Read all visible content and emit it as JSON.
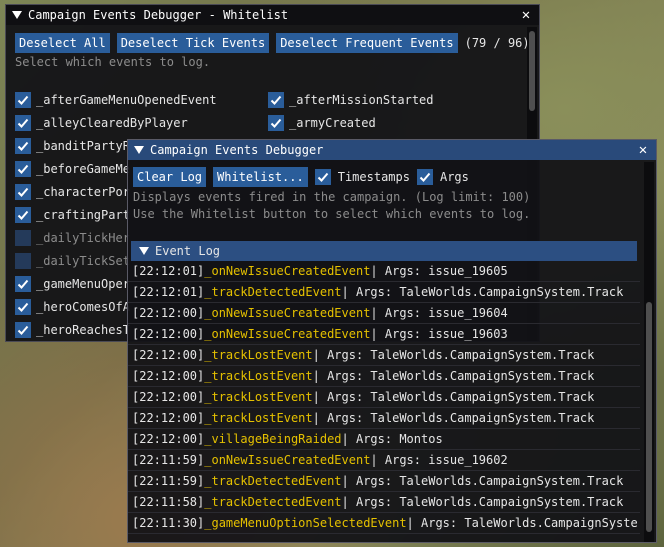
{
  "whitelist": {
    "title": "Campaign Events Debugger - Whitelist",
    "deselect_all": "Deselect All",
    "deselect_tick": "Deselect Tick Events",
    "deselect_frequent": "Deselect Frequent Events",
    "count": "(79 / 96)",
    "hint": "Select which events to log.",
    "left_items": [
      {
        "label": "_afterGameMenuOpenedEvent",
        "checked": true
      },
      {
        "label": "_alleyClearedByPlayer",
        "checked": true
      },
      {
        "label": "_banditPartyR",
        "checked": true
      },
      {
        "label": "_beforeGameMe",
        "checked": true
      },
      {
        "label": "_characterPor",
        "checked": true
      },
      {
        "label": "_craftingPart",
        "checked": true
      },
      {
        "label": "_dailyTickHer",
        "checked": false
      },
      {
        "label": "_dailyTickSet",
        "checked": false
      },
      {
        "label": "_gameMenuOper",
        "checked": true
      },
      {
        "label": "_heroComesOfA",
        "checked": true
      },
      {
        "label": "_heroReachesT",
        "checked": true
      }
    ],
    "right_items": [
      {
        "label": "_afterMissionStarted",
        "checked": true
      },
      {
        "label": "_armyCreated",
        "checked": true
      }
    ]
  },
  "debugger": {
    "title": "Campaign Events Debugger",
    "clear_log": "Clear Log",
    "whitelist_btn": "Whitelist...",
    "timestamps_label": "Timestamps",
    "args_label": "Args",
    "info1": "Displays events fired in the campaign. (Log limit: 100)",
    "info2": "Use the Whitelist button to select which events to log.",
    "event_log_header": "Event Log",
    "log": [
      {
        "time": "[22:12:01]",
        "event": "_onNewIssueCreatedEvent",
        "args": "| Args: issue_19605"
      },
      {
        "time": "[22:12:01]",
        "event": "_trackDetectedEvent",
        "args": "| Args: TaleWorlds.CampaignSystem.Track"
      },
      {
        "time": "[22:12:00]",
        "event": "_onNewIssueCreatedEvent",
        "args": "| Args: issue_19604"
      },
      {
        "time": "[22:12:00]",
        "event": "_onNewIssueCreatedEvent",
        "args": "| Args: issue_19603"
      },
      {
        "time": "[22:12:00]",
        "event": "_trackLostEvent",
        "args": "| Args: TaleWorlds.CampaignSystem.Track"
      },
      {
        "time": "[22:12:00]",
        "event": "_trackLostEvent",
        "args": "| Args: TaleWorlds.CampaignSystem.Track"
      },
      {
        "time": "[22:12:00]",
        "event": "_trackLostEvent",
        "args": "| Args: TaleWorlds.CampaignSystem.Track"
      },
      {
        "time": "[22:12:00]",
        "event": "_trackLostEvent",
        "args": "| Args: TaleWorlds.CampaignSystem.Track"
      },
      {
        "time": "[22:12:00]",
        "event": "_villageBeingRaided",
        "args": "| Args: Montos"
      },
      {
        "time": "[22:11:59]",
        "event": "_onNewIssueCreatedEvent",
        "args": "| Args: issue_19602"
      },
      {
        "time": "[22:11:59]",
        "event": "_trackDetectedEvent",
        "args": "| Args: TaleWorlds.CampaignSystem.Track"
      },
      {
        "time": "[22:11:58]",
        "event": "_trackDetectedEvent",
        "args": "| Args: TaleWorlds.CampaignSystem.Track"
      },
      {
        "time": "[22:11:30]",
        "event": "_gameMenuOptionSelectedEvent",
        "args": "| Args: TaleWorlds.CampaignSyste"
      }
    ]
  }
}
